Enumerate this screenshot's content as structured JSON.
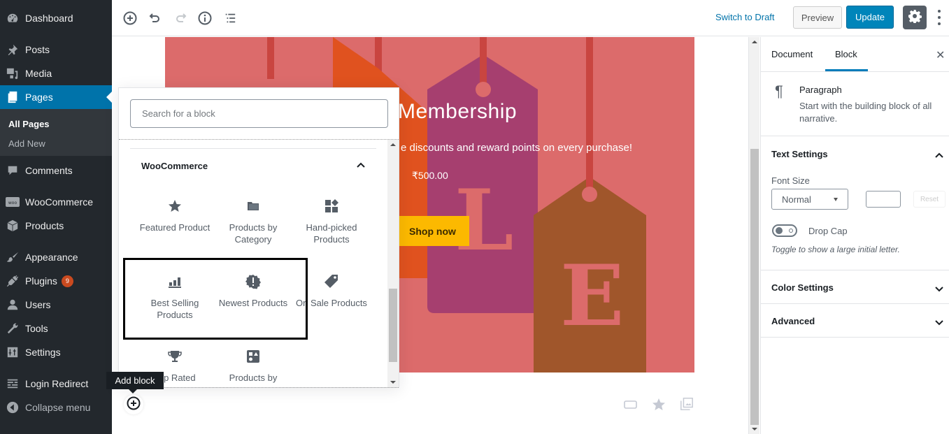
{
  "sidebar": {
    "items": [
      {
        "label": "Dashboard",
        "icon": "dashboard-icon"
      },
      {
        "label": "Posts",
        "icon": "pin-icon"
      },
      {
        "label": "Media",
        "icon": "media-icon"
      },
      {
        "label": "Pages",
        "icon": "pages-icon",
        "active": true
      },
      {
        "label": "Comments",
        "icon": "comment-icon"
      },
      {
        "label": "WooCommerce",
        "icon": "woo-icon"
      },
      {
        "label": "Products",
        "icon": "box-icon"
      },
      {
        "label": "Appearance",
        "icon": "brush-icon"
      },
      {
        "label": "Plugins",
        "icon": "plugin-icon",
        "badge": "9"
      },
      {
        "label": "Users",
        "icon": "user-icon"
      },
      {
        "label": "Tools",
        "icon": "wrench-icon"
      },
      {
        "label": "Settings",
        "icon": "settings-icon"
      },
      {
        "label": "Login Redirect",
        "icon": "list-icon"
      },
      {
        "label": "Collapse menu",
        "icon": "collapse-icon"
      }
    ],
    "submenu": [
      {
        "label": "All Pages",
        "current": true
      },
      {
        "label": "Add New"
      }
    ]
  },
  "toolbar": {
    "icons": [
      "add-block-icon",
      "undo-icon",
      "redo-icon",
      "info-icon",
      "outline-icon"
    ],
    "switch_to_draft": "Switch to Draft",
    "preview": "Preview",
    "update": "Update",
    "settings_icon": "gear-icon",
    "more_icon": "more-vertical-icon"
  },
  "cover": {
    "title": "Membership",
    "text": "e discounts and reward points on every purchase!",
    "price": "₹500.00",
    "button": "Shop now",
    "letters": [
      "L",
      "E"
    ],
    "colors": {
      "background": "#dc6b6b",
      "string": "#c94540",
      "tag_orange": "#e0521f",
      "tag_purple": "#a63f6f",
      "tag_brown": "#a0562b",
      "button": "#fcb900"
    }
  },
  "inserter": {
    "search_placeholder": "Search for a block",
    "panel_title": "WooCommerce",
    "blocks": [
      {
        "label": "Featured Product",
        "icon": "star-icon"
      },
      {
        "label": "Products by Category",
        "icon": "folder-icon"
      },
      {
        "label": "Hand-picked Products",
        "icon": "widgets-icon"
      },
      {
        "label": "Best Selling Products",
        "icon": "bar-chart-icon"
      },
      {
        "label": "Newest Products",
        "icon": "new-badge-icon"
      },
      {
        "label": "On Sale Products",
        "icon": "tag-icon"
      },
      {
        "label": "Top Rated",
        "icon": "trophy-icon"
      },
      {
        "label": "Products by",
        "icon": "shapes-icon"
      }
    ]
  },
  "tooltip": "Add block",
  "editor_bottom_icons": [
    "rectangle-icon",
    "star-icon",
    "gallery-icon"
  ],
  "settings_sidebar": {
    "tabs": [
      {
        "label": "Document"
      },
      {
        "label": "Block",
        "active": true
      }
    ],
    "block": {
      "name": "Paragraph",
      "description": "Start with the building block of all narrative."
    },
    "text_settings": {
      "title": "Text Settings",
      "font_size_label": "Font Size",
      "font_size_value": "Normal",
      "custom_size": "",
      "reset": "Reset",
      "drop_cap_label": "Drop Cap",
      "drop_cap_enabled": false,
      "drop_cap_help": "Toggle to show a large initial letter."
    },
    "color_settings": "Color Settings",
    "advanced": "Advanced"
  }
}
